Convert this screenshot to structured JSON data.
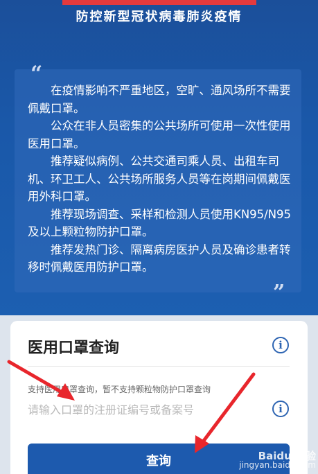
{
  "banner": {
    "title": "防控新型冠状病毒肺炎疫情",
    "paragraphs": [
      "在疫情影响不严重地区，空旷、通风场所不需要佩戴口罩。",
      "公众在非人员密集的公共场所可使用一次性使用医用口罩。",
      "推荐疑似病例、公共交通司乘人员、出租车司机、环卫工人、公共场所服务人员等在岗期间佩戴医用外科口罩。",
      "推荐现场调查、采样和检测人员使用KN95/N95及以上颗粒物防护口罩。",
      "推荐发热门诊、隔离病房医护人员及确诊患者转移时佩戴医用防护口罩。"
    ],
    "quote_open": "“",
    "quote_close": "”"
  },
  "query_card": {
    "title": "医用口罩查询",
    "info_icon": "i",
    "support_note": "支持医用口罩查询，暂不支持颗粒物防护口罩查询",
    "input_placeholder": "请输入口罩的注册证编号或备案号",
    "input_value": "",
    "submit_label": "查询"
  },
  "watermark": {
    "line1": "Baidu 经验",
    "line2": "jingyan.baidu.com"
  },
  "colors": {
    "banner_blue": "#1a58a9",
    "accent_red": "#e43a3d",
    "button_blue": "#1d5aae",
    "annotation_arrow": "#e8262c"
  },
  "icons": [
    "quote-open-icon",
    "quote-close-icon",
    "info-icon",
    "annotation-arrow-icon"
  ]
}
